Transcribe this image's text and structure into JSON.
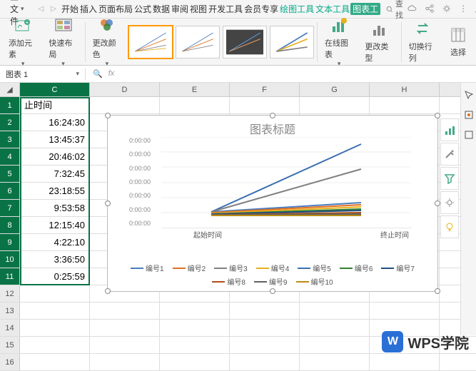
{
  "topbar": {
    "file_btn": "三 文件",
    "menu_tabs": [
      "开始",
      "插入",
      "页面布局",
      "公式",
      "数据",
      "审阅",
      "视图",
      "开发工具",
      "会员专享"
    ],
    "ctx_tabs": [
      "绘图工具",
      "文本工具",
      "图表工"
    ],
    "search": "查找"
  },
  "ribbon": {
    "addelem": "添加元素",
    "quicklayout": "快速布局",
    "changecolor": "更改颜色",
    "onlinechart": "在线图表",
    "changetype": "更改类型",
    "switchrc": "切换行列",
    "select": "选择"
  },
  "namebox": "图表 1",
  "col_headers": [
    "C",
    "D",
    "E",
    "F",
    "G",
    "H"
  ],
  "row_numbers": [
    "1",
    "2",
    "3",
    "4",
    "5",
    "6",
    "7",
    "8",
    "9",
    "10",
    "11",
    "12",
    "13",
    "14",
    "15",
    "16"
  ],
  "data": {
    "header": "止时间",
    "rows": [
      "16:24:30",
      "13:45:37",
      "20:46:02",
      "7:32:45",
      "23:18:55",
      "9:53:58",
      "12:15:40",
      "4:22:10",
      "3:36:50",
      "0:25:59"
    ]
  },
  "chart": {
    "title": "图表标题",
    "yticks": [
      "0:00:00",
      "0:00:00",
      "0:00:00",
      "0:00:00",
      "0:00:00",
      "0:00:00",
      "0:00:00"
    ],
    "xticks": [
      "起始时间",
      "终止时间"
    ],
    "legend": [
      {
        "name": "编号1",
        "color": "#4a7cbf"
      },
      {
        "name": "编号2",
        "color": "#e07020"
      },
      {
        "name": "编号3",
        "color": "#808080"
      },
      {
        "name": "编号4",
        "color": "#e8b020"
      },
      {
        "name": "编号5",
        "color": "#3a6fb0"
      },
      {
        "name": "编号6",
        "color": "#308030"
      },
      {
        "name": "编号7",
        "color": "#205080"
      },
      {
        "name": "编号8",
        "color": "#b05018"
      },
      {
        "name": "编号9",
        "color": "#606060"
      },
      {
        "name": "编号10",
        "color": "#bb8c12"
      }
    ]
  },
  "chart_data": {
    "type": "line",
    "title": "图表标题",
    "xlabel": "",
    "ylabel": "",
    "categories": [
      "起始时间",
      "终止时间"
    ],
    "series": [
      {
        "name": "编号1",
        "values": [
          "0:00:00",
          "16:24:30"
        ]
      },
      {
        "name": "编号2",
        "values": [
          "0:00:00",
          "13:45:37"
        ]
      },
      {
        "name": "编号3",
        "values": [
          "0:00:00",
          "20:46:02"
        ]
      },
      {
        "name": "编号4",
        "values": [
          "0:00:00",
          "7:32:45"
        ]
      },
      {
        "name": "编号5",
        "values": [
          "0:00:00",
          "23:18:55"
        ]
      },
      {
        "name": "编号6",
        "values": [
          "0:00:00",
          "9:53:58"
        ]
      },
      {
        "name": "编号7",
        "values": [
          "0:00:00",
          "12:15:40"
        ]
      },
      {
        "name": "编号8",
        "values": [
          "0:00:00",
          "4:22:10"
        ]
      },
      {
        "name": "编号9",
        "values": [
          "0:00:00",
          "3:36:50"
        ]
      },
      {
        "name": "编号10",
        "values": [
          "0:00:00",
          "0:25:59"
        ]
      }
    ]
  },
  "watermark": "WPS学院"
}
